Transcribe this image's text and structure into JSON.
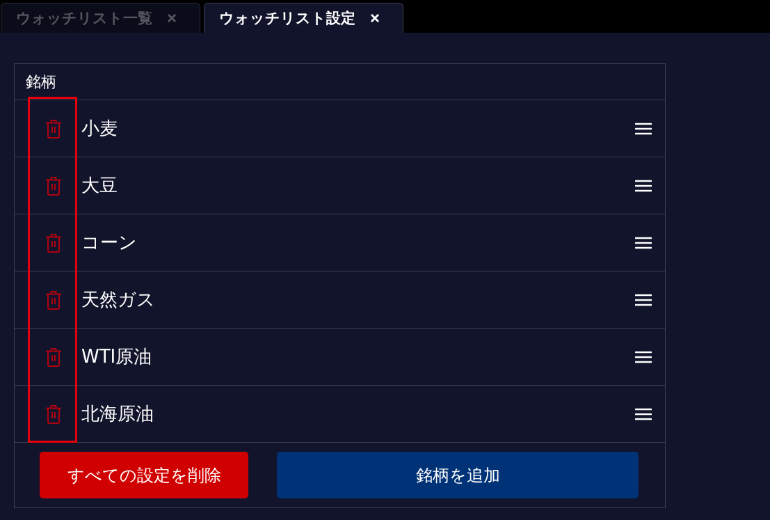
{
  "tabs": [
    {
      "label": "ウォッチリスト一覧",
      "selected": false
    },
    {
      "label": "ウォッチリスト設定",
      "selected": true
    }
  ],
  "table": {
    "column_header": "銘柄",
    "rows": [
      {
        "name": "小麦"
      },
      {
        "name": "大豆"
      },
      {
        "name": "コーン"
      },
      {
        "name": "天然ガス"
      },
      {
        "name": "WTI原油"
      },
      {
        "name": "北海原油"
      }
    ]
  },
  "buttons": [
    {
      "kind": "danger",
      "label": "すべての設定を削除"
    },
    {
      "kind": "primary",
      "label": "銘柄を追加"
    }
  ],
  "highlight": {
    "kind": "delete_column"
  }
}
